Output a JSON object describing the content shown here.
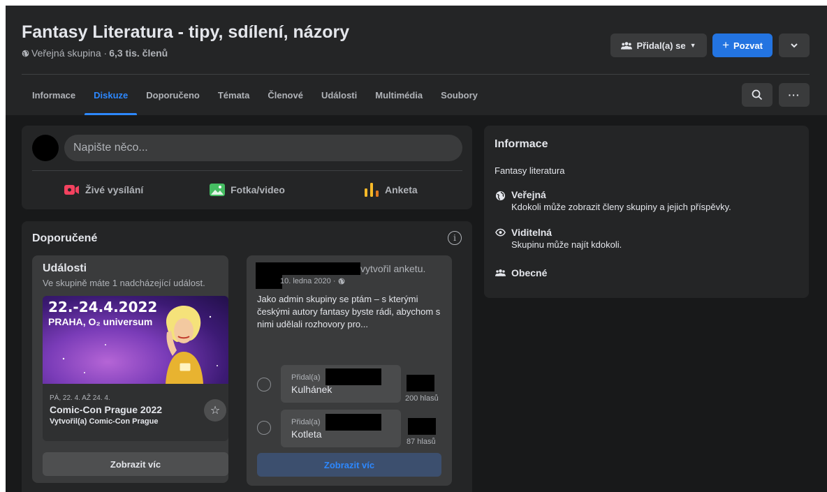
{
  "group": {
    "title": "Fantasy Literatura - tipy, sdílení, názory",
    "privacy": "Veřejná skupina · ",
    "members": "6,3 tis. členů"
  },
  "header_buttons": {
    "joined": "Přidal(a) se",
    "invite": "Pozvat"
  },
  "tabs": [
    {
      "label": "Informace"
    },
    {
      "label": "Diskuze",
      "active": true
    },
    {
      "label": "Doporučeno"
    },
    {
      "label": "Témata"
    },
    {
      "label": "Členové"
    },
    {
      "label": "Události"
    },
    {
      "label": "Multimédia"
    },
    {
      "label": "Soubory"
    }
  ],
  "composer": {
    "placeholder": "Napište něco...",
    "actions": {
      "live": "Živé vysílání",
      "photo": "Fotka/video",
      "poll": "Anketa"
    }
  },
  "recommended": {
    "title": "Doporučené",
    "events": {
      "title": "Události",
      "subtitle": "Ve skupině máte 1 nadcházející událost.",
      "image_date": "22.-24.4.2022",
      "image_place": "PRAHA, O₂ universum",
      "date": "PÁ, 22. 4. AŽ 24. 4.",
      "name": "Comic-Con Prague 2022",
      "created_by": "Vytvořil(a) Comic-Con Prague",
      "more": "Zobrazit víc"
    },
    "poll": {
      "created": "vytvořil anketu.",
      "date": "10. ledna 2020 ·",
      "text": "Jako admin skupiny se ptám – s kterými českými autory fantasy byste rádi, abychom s nimi udělali rozhovory pro...",
      "options": [
        {
          "added": "Přidal(a)",
          "name": "Kulhánek",
          "votes": "200 hlasů"
        },
        {
          "added": "Přidal(a)",
          "name": "Kotleta",
          "votes": "87 hlasů"
        }
      ],
      "more": "Zobrazit víc"
    }
  },
  "info": {
    "title": "Informace",
    "description": "Fantasy literatura",
    "items": [
      {
        "title": "Veřejná",
        "desc": "Kdokoli může zobrazit členy skupiny a jejich příspěvky."
      },
      {
        "title": "Viditelná",
        "desc": "Skupinu může najít kdokoli."
      },
      {
        "title": "Obecné",
        "desc": ""
      }
    ]
  },
  "colors": {
    "background": "#18191a",
    "card": "#242526",
    "accent": "#2d88ff",
    "primary_button": "#2374e1"
  }
}
